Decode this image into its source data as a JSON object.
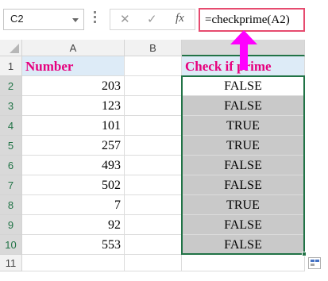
{
  "formula_bar": {
    "name_box": "C2",
    "cancel_glyph": "✕",
    "enter_glyph": "✓",
    "fx_label": "fx",
    "formula": "=checkprime(A2)"
  },
  "columns": [
    "A",
    "B",
    "C"
  ],
  "rows": [
    "1",
    "2",
    "3",
    "4",
    "5",
    "6",
    "7",
    "8",
    "9",
    "10",
    "11"
  ],
  "header": {
    "number": "Number",
    "check": "Check if prime"
  },
  "data": [
    {
      "number": "203",
      "result": "FALSE"
    },
    {
      "number": "123",
      "result": "FALSE"
    },
    {
      "number": "101",
      "result": "TRUE"
    },
    {
      "number": "257",
      "result": "TRUE"
    },
    {
      "number": "493",
      "result": "FALSE"
    },
    {
      "number": "502",
      "result": "FALSE"
    },
    {
      "number": "7",
      "result": "TRUE"
    },
    {
      "number": "92",
      "result": "FALSE"
    },
    {
      "number": "553",
      "result": "FALSE"
    }
  ],
  "colors": {
    "accent": "#217346",
    "header_text": "#e6007e",
    "header_fill": "#ddebf7",
    "result_fill": "#c9c9c9",
    "formula_border": "#e64b6f",
    "arrow": "#ff00ff"
  }
}
